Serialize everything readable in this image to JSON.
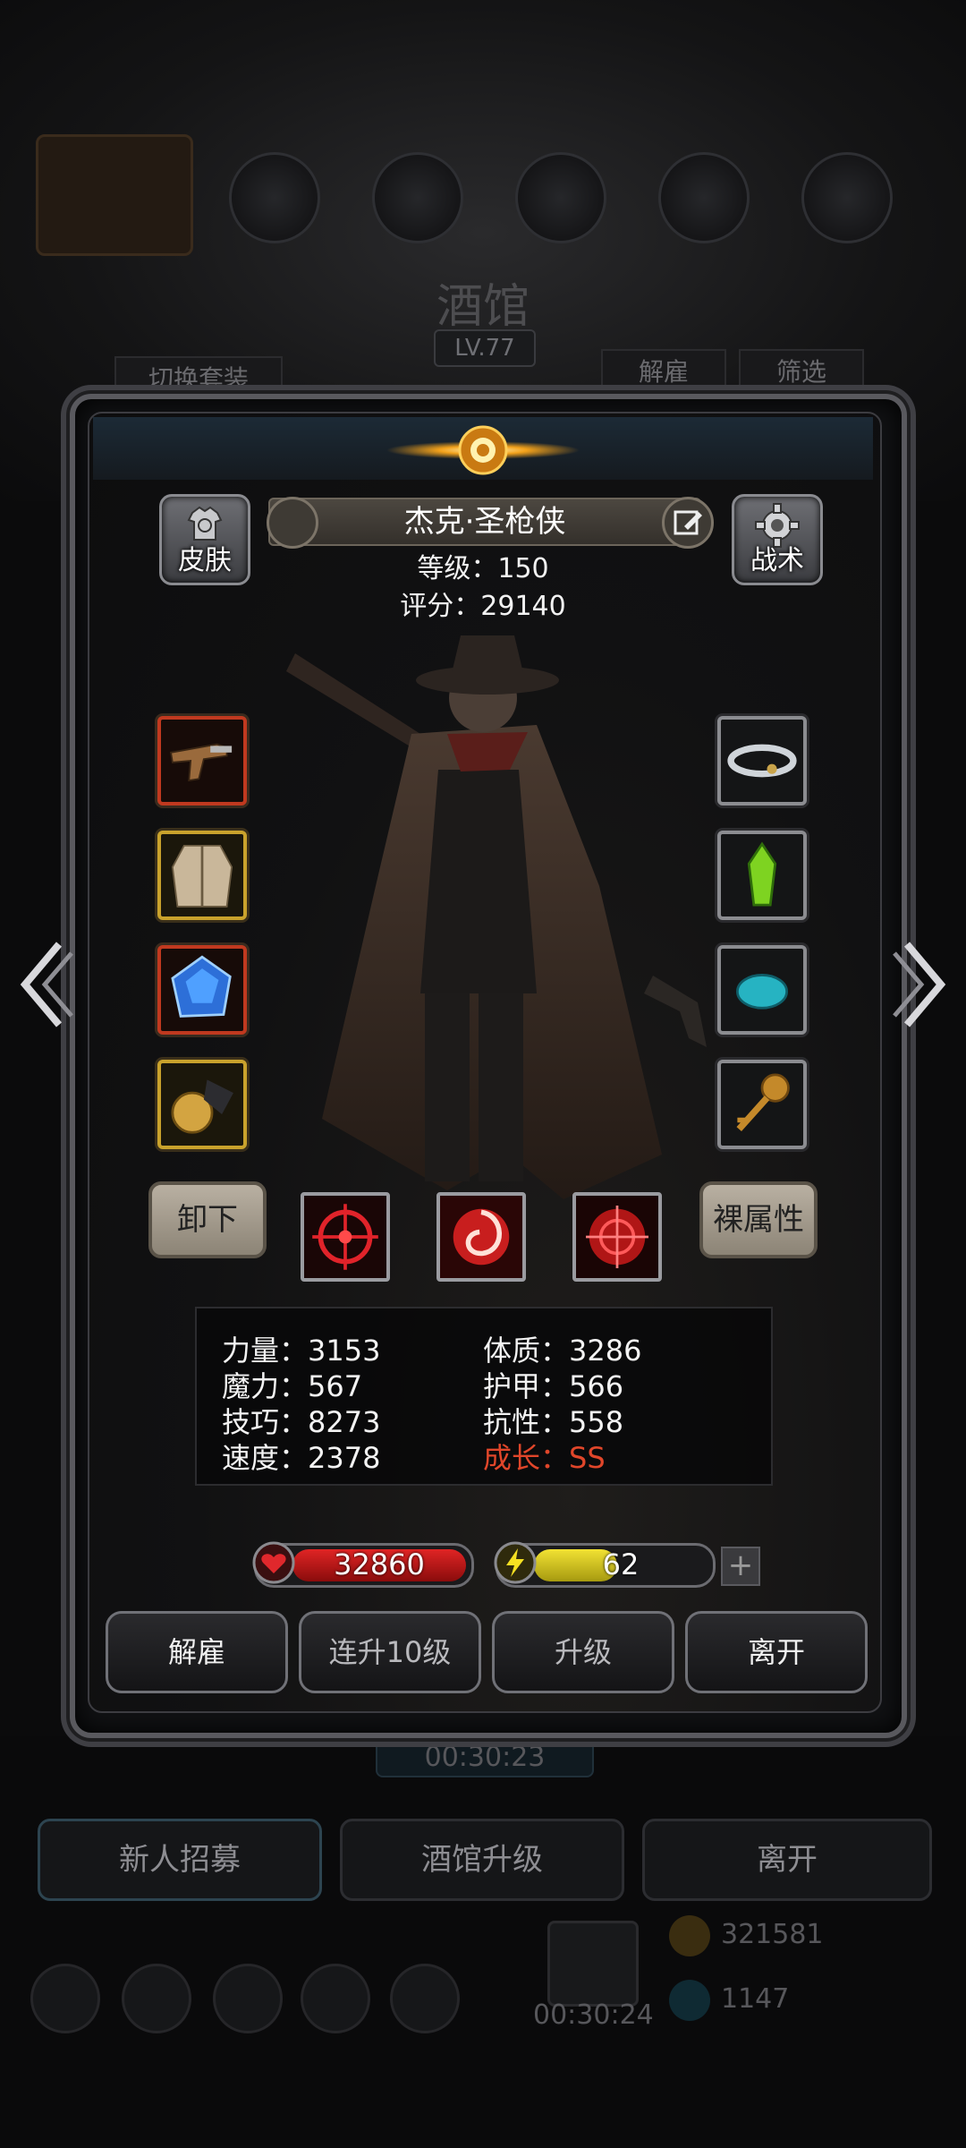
{
  "background": {
    "title": "酒馆",
    "level_badge": "LV.77",
    "switch_outfit_label": "切换套装",
    "dismiss_label": "解雇",
    "filter_label": "筛选",
    "timer_center": "00:30:23",
    "timer_bottom": "00:30:24",
    "bottom_buttons": [
      "新人招募",
      "酒馆升级",
      "离开"
    ],
    "gold_amount": "321581",
    "gem_amount": "1147"
  },
  "hero": {
    "skin_label": "皮肤",
    "tactics_label": "战术",
    "name": "杰克·圣枪侠",
    "level_text": "等级：150",
    "score_text": "评分：29140"
  },
  "equipment": {
    "left": [
      {
        "name": "flintlock-pistol",
        "rarity_color": "#c0391f"
      },
      {
        "name": "fur-coat",
        "rarity_color": "#c9a22c"
      },
      {
        "name": "blue-gem",
        "rarity_color": "#c0391f"
      },
      {
        "name": "gold-coin-pouch",
        "rarity_color": "#c9a22c"
      }
    ],
    "right": [
      {
        "name": "storm-cloud-ring",
        "rarity_color": "#8b8c90"
      },
      {
        "name": "green-crystal",
        "rarity_color": "#8b8c90"
      },
      {
        "name": "teal-stone",
        "rarity_color": "#8b8c90"
      },
      {
        "name": "ornate-key",
        "rarity_color": "#8b8c90"
      }
    ]
  },
  "actions": {
    "unequip_label": "卸下",
    "base_stats_label": "裸属性"
  },
  "skills": [
    "crosshair-skill",
    "swirl-skill",
    "target-skill"
  ],
  "stats": {
    "strength": "力量：3153",
    "magic": "魔力：567",
    "skill": "技巧：8273",
    "speed": "速度：2378",
    "constitution": "体质：3286",
    "armor": "护甲：566",
    "resistance": "抗性：558",
    "growth": "成长：SS"
  },
  "resources": {
    "hp": "32860",
    "energy": "62",
    "energy_fraction": 0.48,
    "plus_label": "+"
  },
  "bottom_actions": [
    "解雇",
    "连升10级",
    "升级",
    "离开"
  ],
  "colors": {
    "growth_accent": "#e0462a",
    "hp_bar": "#d41c1c",
    "energy_bar": "#e8d82a"
  }
}
